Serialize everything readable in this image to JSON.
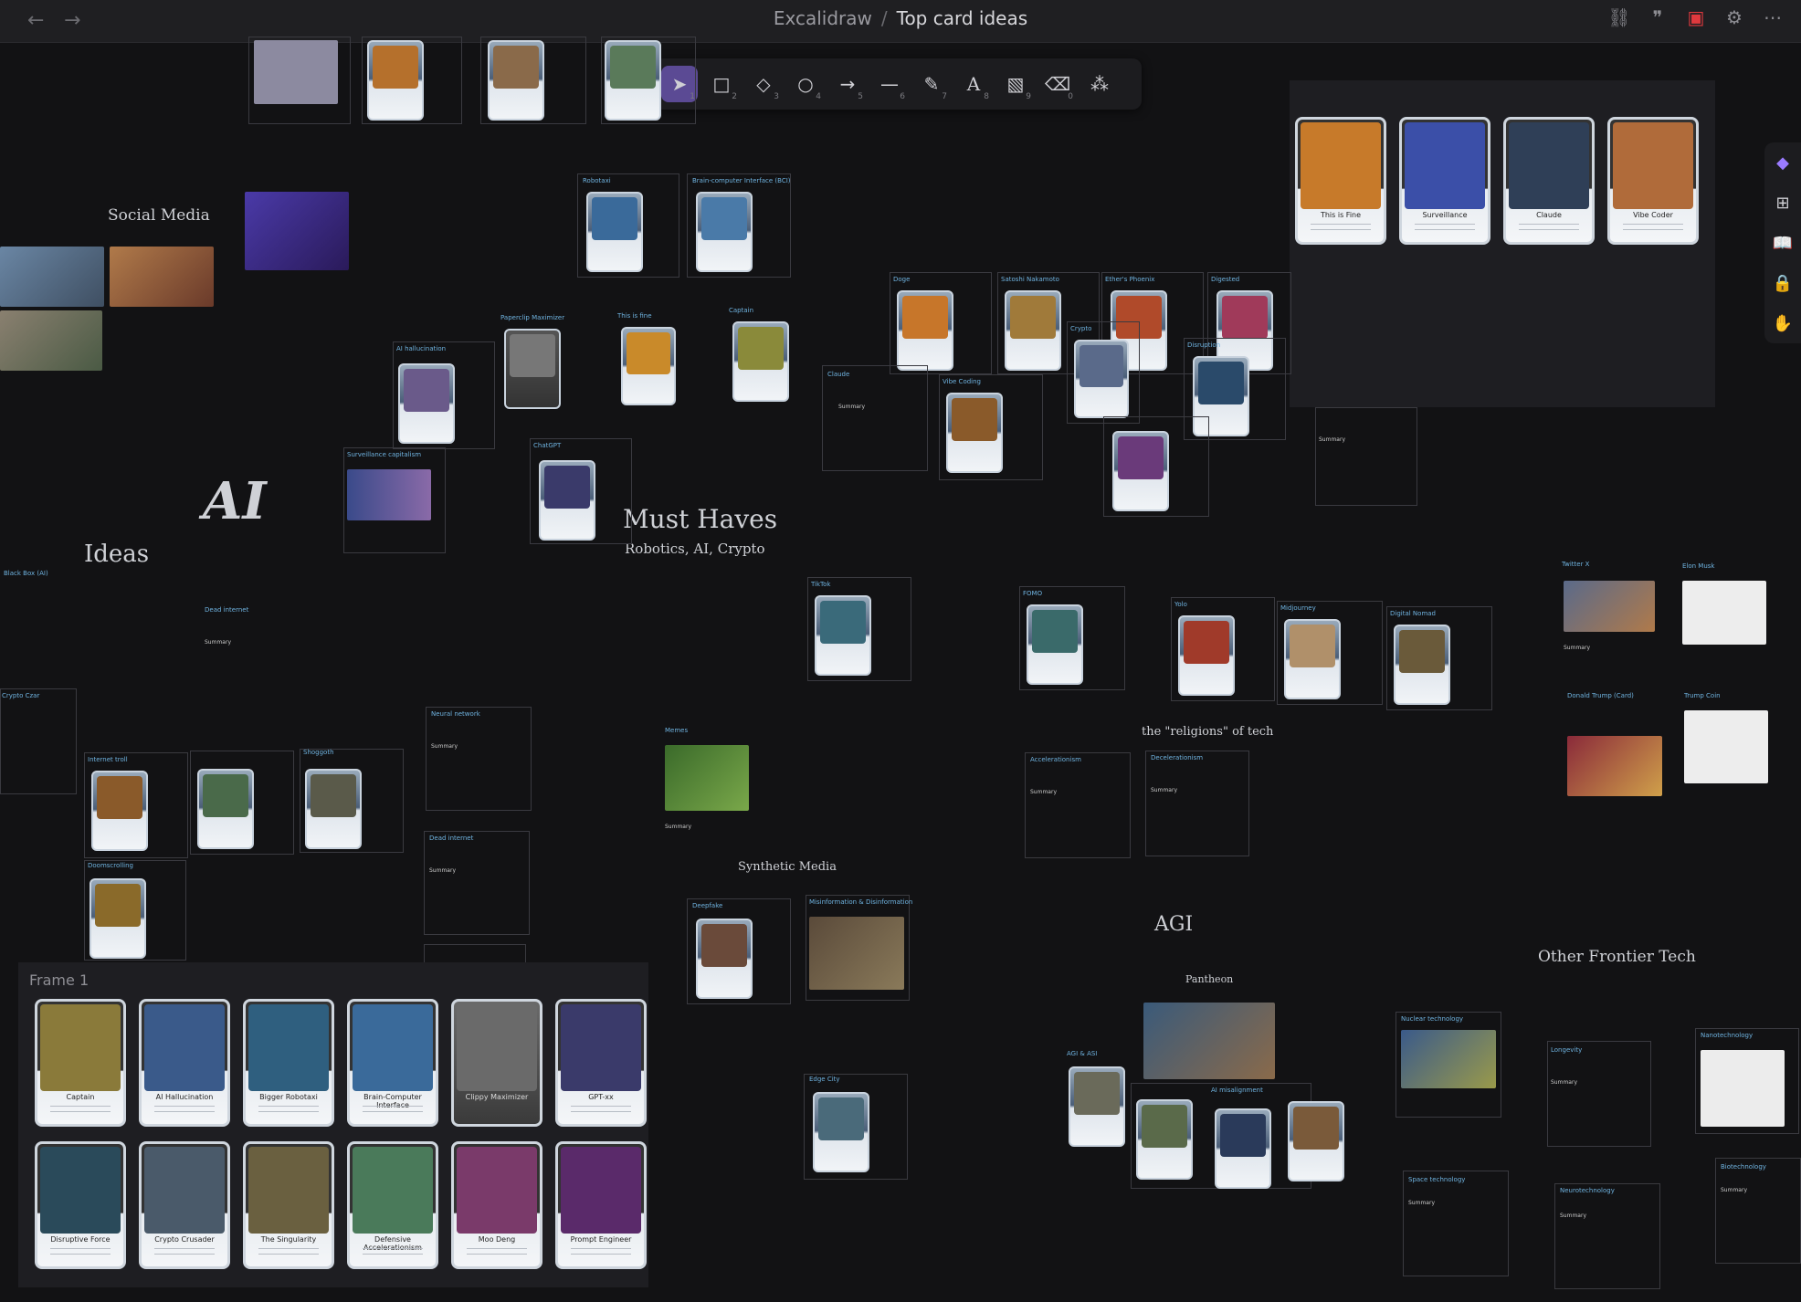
{
  "topbar": {
    "back_icon": "arrow-left-icon",
    "forward_icon": "arrow-right-icon",
    "workspace": "Excalidraw",
    "separator": "/",
    "title": "Top card ideas",
    "right_icons": [
      "link-icon",
      "quote-icon",
      "save-icon",
      "settings-icon",
      "more-icon"
    ]
  },
  "toolbar": {
    "tools": [
      {
        "name": "selection",
        "icon": "pointer-icon",
        "key": "1",
        "active": true
      },
      {
        "name": "rectangle",
        "icon": "square-icon",
        "key": "2"
      },
      {
        "name": "diamond",
        "icon": "diamond-icon",
        "key": "3"
      },
      {
        "name": "ellipse",
        "icon": "circle-icon",
        "key": "4"
      },
      {
        "name": "arrow",
        "icon": "arrow-icon",
        "key": "5"
      },
      {
        "name": "line",
        "icon": "line-icon",
        "key": "6"
      },
      {
        "name": "draw",
        "icon": "pencil-icon",
        "key": "7"
      },
      {
        "name": "text",
        "icon": "text-icon",
        "key": "8"
      },
      {
        "name": "image",
        "icon": "image-icon",
        "key": "9"
      },
      {
        "name": "eraser",
        "icon": "eraser-icon",
        "key": "0"
      },
      {
        "name": "more-tools",
        "icon": "shapes-icon",
        "key": ""
      }
    ],
    "accent": "#5b4a94"
  },
  "rightbar": {
    "icons": [
      "obsidian-icon",
      "add-file-icon",
      "book-icon",
      "lock-icon",
      "hand-icon"
    ]
  },
  "canvas": {
    "headings": {
      "social_media": "Social Media",
      "ai": "AI",
      "ideas": "Ideas",
      "must_haves": "Must Haves",
      "must_haves_sub": "Robotics, AI, Crypto",
      "religions": "the \"religions\" of tech",
      "synthetic_media": "Synthetic Media",
      "agi": "AGI",
      "pantheon": "Pantheon",
      "other_frontier": "Other Frontier Tech",
      "frame1": "Frame 1"
    },
    "small_notes": [
      "Robotaxi",
      "Brain-computer Interface (BCI)",
      "Paperclip Maximizer",
      "This is fine",
      "Captain",
      "AI hallucination",
      "Surveillance capitalism",
      "ChatGPT",
      "Doge",
      "Satoshi Nakamoto",
      "Ether's Phoenix",
      "Digested",
      "Crypto",
      "Disruption",
      "Claude",
      "Vibe Coding",
      "TikTok",
      "FOMO",
      "Yolo",
      "Midjourney",
      "Digital Nomad",
      "Dead internet",
      "Neural network",
      "Memes",
      "Internet troll",
      "Doomscrolling",
      "Shoggoth",
      "Accelerationism",
      "Decelerationism",
      "Deepfake",
      "Misinformation & Disinformation",
      "Edge City",
      "AGI & ASI",
      "AI misalignment",
      "Nuclear technology",
      "Longevity",
      "Nanotechnology",
      "Space technology",
      "Neurotechnology",
      "Biotechnology",
      "Twitter X",
      "Elon Musk",
      "Donald Trump (Card)",
      "Trump Coin",
      "Black Box (AI)",
      "Crypto Czar",
      "Summary"
    ],
    "featured_cards": [
      {
        "name": "This is Fine",
        "color": "#c77a2a"
      },
      {
        "name": "Surveillance",
        "color": "#3b4fa8"
      },
      {
        "name": "Claude",
        "color": "#2f3f57"
      },
      {
        "name": "Vibe Coder",
        "color": "#b06b3a"
      }
    ],
    "frame1_cards": [
      {
        "name": "Captain",
        "color": "#8a7a3a"
      },
      {
        "name": "AI Hallucination",
        "color": "#3a5a8a"
      },
      {
        "name": "Bigger Robotaxi",
        "color": "#2f5f7f"
      },
      {
        "name": "Brain-Computer Interface",
        "color": "#3a6a9a"
      },
      {
        "name": "Clippy Maximizer",
        "color": "#6a6a6a"
      },
      {
        "name": "GPT-xx",
        "color": "#3a3a6a"
      },
      {
        "name": "Disruptive Force",
        "color": "#2a4a5a"
      },
      {
        "name": "Crypto Crusader",
        "color": "#4a5a6a"
      },
      {
        "name": "The Singularity",
        "color": "#6a6040"
      },
      {
        "name": "Defensive Accelerationism",
        "color": "#4a7a5a"
      },
      {
        "name": "Moo Deng",
        "color": "#7a3a6a"
      },
      {
        "name": "Prompt Engineer",
        "color": "#5a2a6a"
      }
    ],
    "frame1_card_lines": [
      "Spell / Crypto Chip",
      "Summary"
    ]
  }
}
